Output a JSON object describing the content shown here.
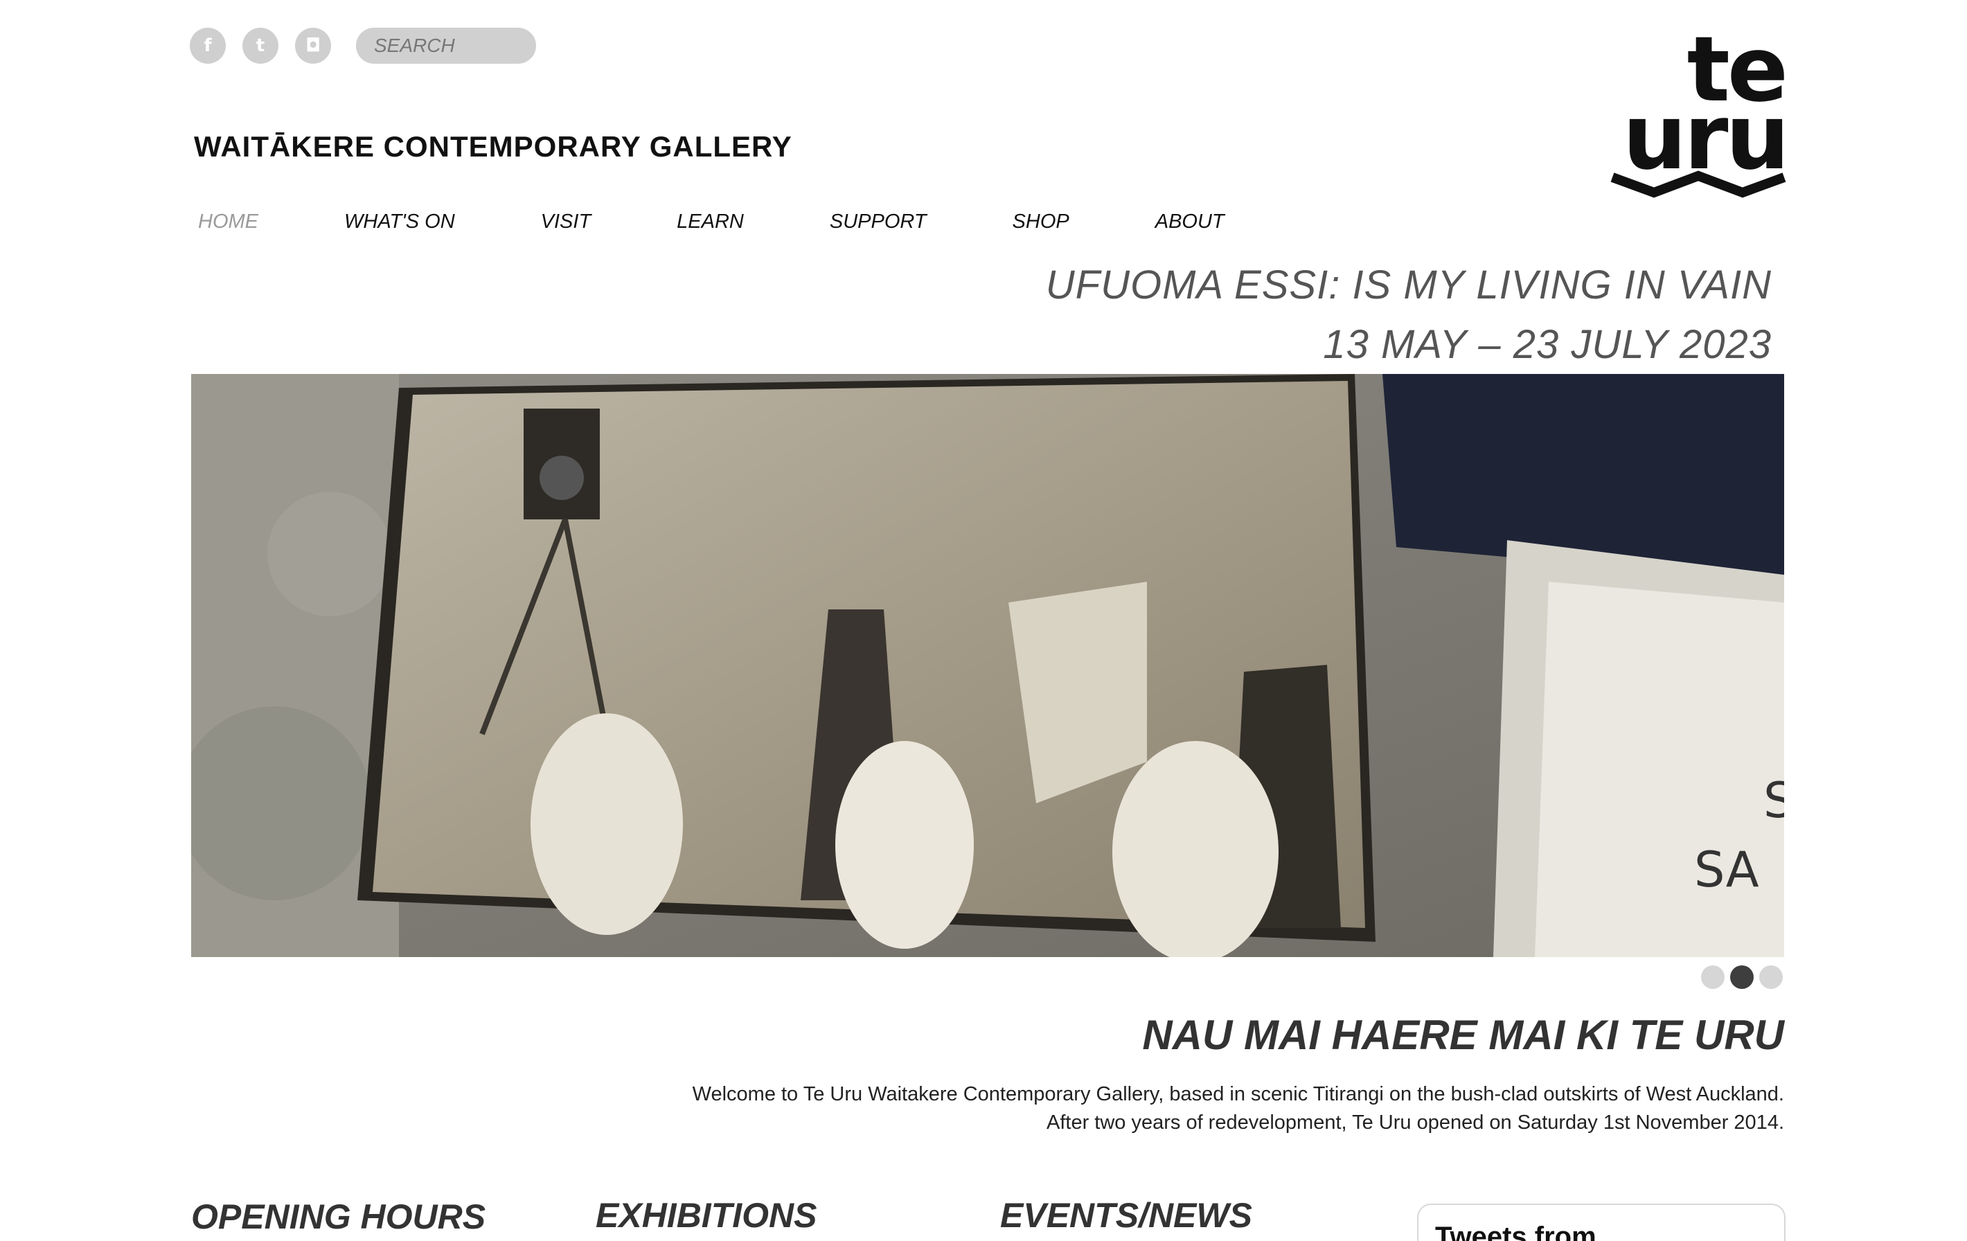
{
  "social": {
    "facebook_glyph": "f",
    "twitter_glyph": "t",
    "instagram_glyph": "◘"
  },
  "search": {
    "placeholder": "SEARCH"
  },
  "site_title": "WAITĀKERE CONTEMPORARY GALLERY",
  "logo": {
    "line1": "te",
    "line2": "uru"
  },
  "nav": {
    "home": "HOME",
    "whats_on": "WHAT'S ON",
    "visit": "VISIT",
    "learn": "LEARN",
    "support": "SUPPORT",
    "shop": "SHOP",
    "about": "ABOUT"
  },
  "slide": {
    "title": "UFUOMA ESSI: IS MY LIVING IN VAIN",
    "dates": "13 MAY – 23 JULY 2023",
    "active_index": 1,
    "count": 3
  },
  "welcome": {
    "heading": "NAU MAI HAERE MAI KI TE URU",
    "line1": "Welcome to Te Uru Waitakere Contemporary Gallery, based in scenic Titirangi on the bush-clad outskirts of West Auckland.",
    "line2": "After two years of redevelopment, Te Uru opened on Saturday 1st November 2014."
  },
  "sections": {
    "opening_hours": "OPENING HOURS",
    "exhibitions": "EXHIBITIONS",
    "events_news": "EVENTS/NEWS",
    "tweets": "Tweets from"
  }
}
